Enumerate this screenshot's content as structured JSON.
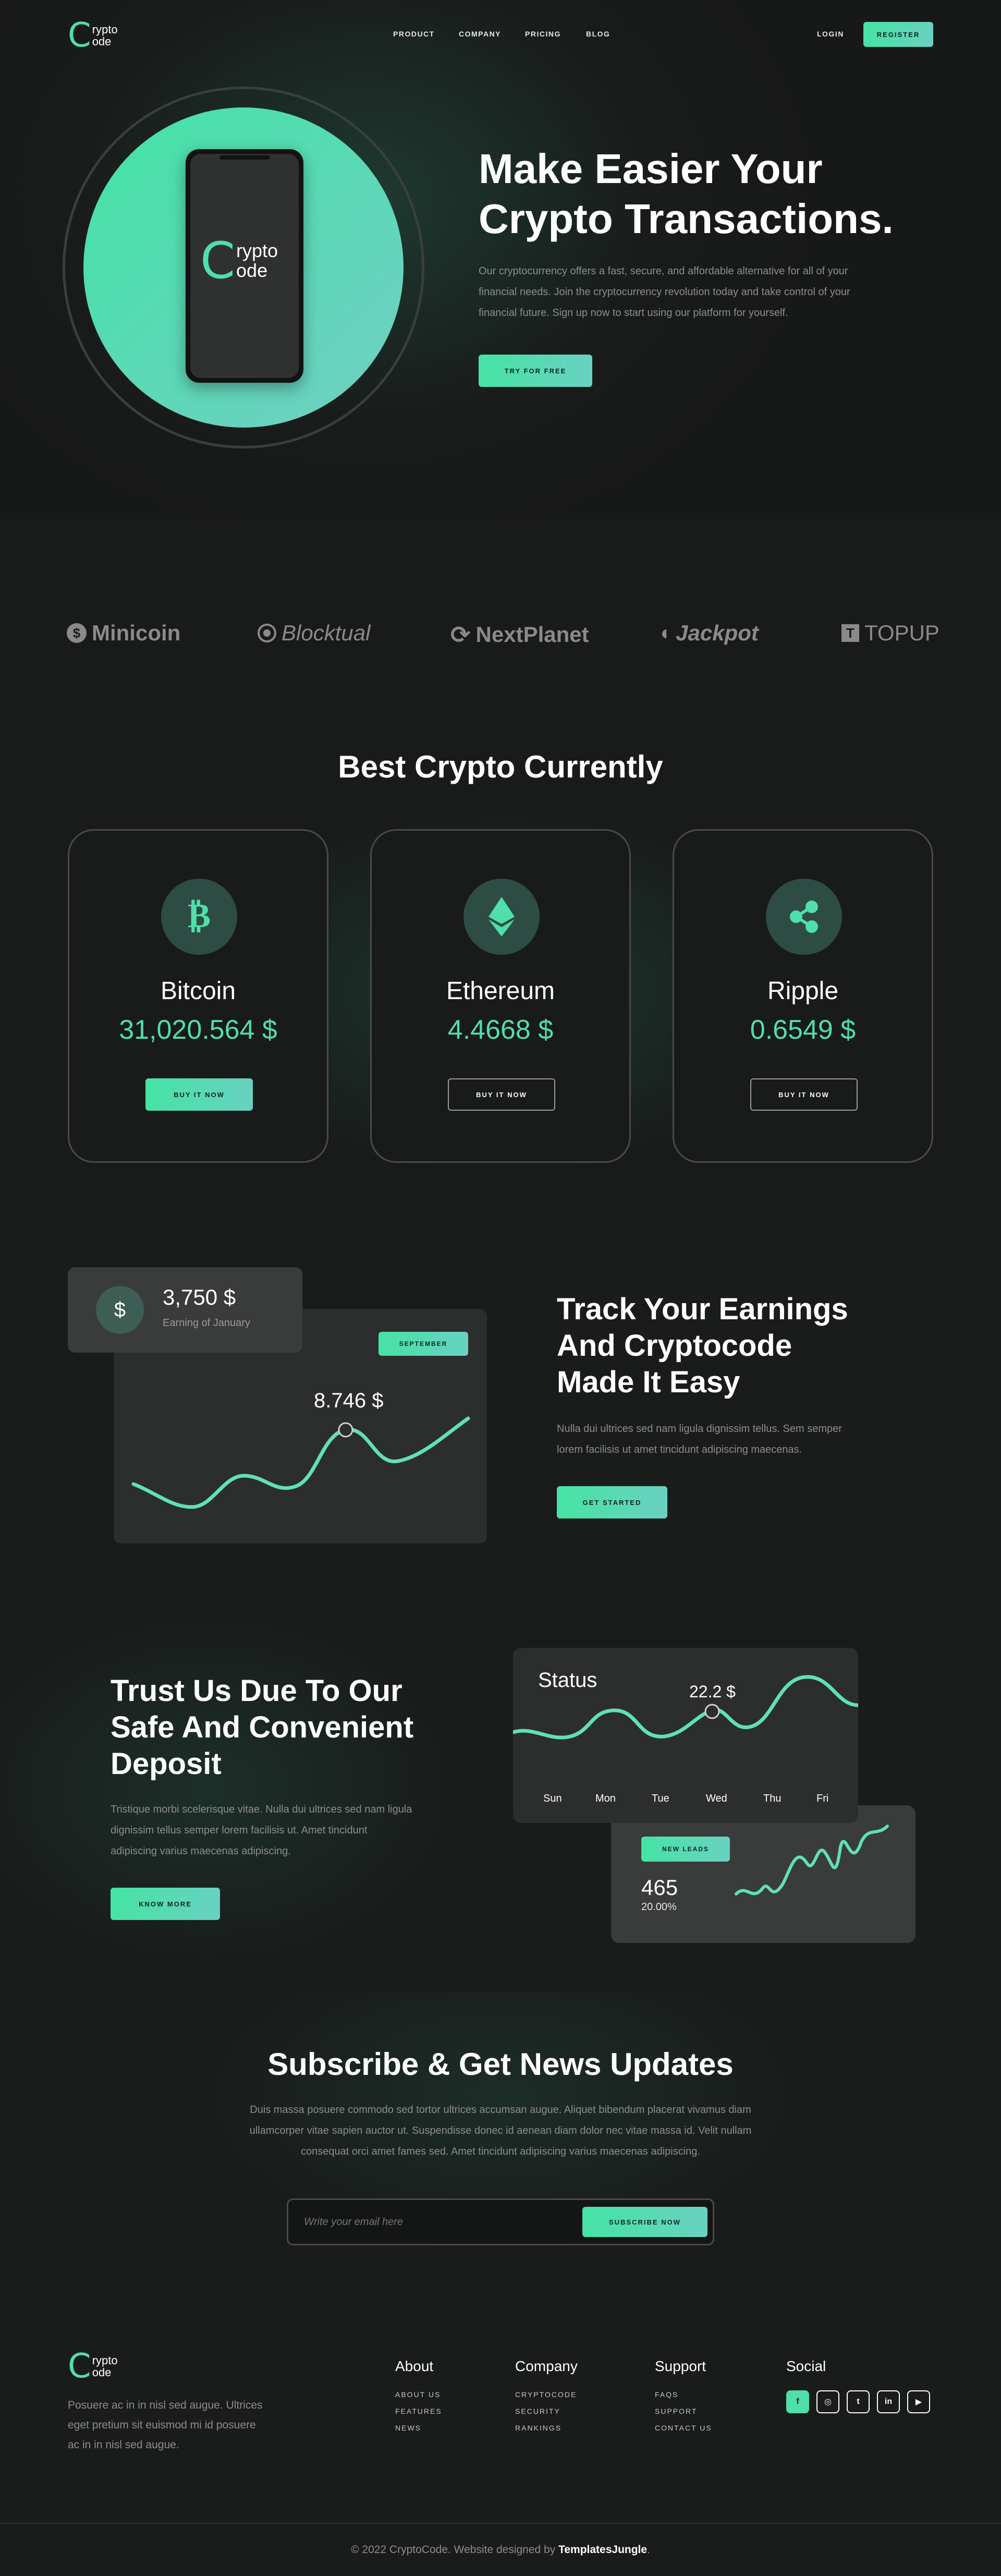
{
  "brand": {
    "logo_c": "C",
    "logo_top": "rypto",
    "logo_bottom": "ode"
  },
  "nav": {
    "links": [
      "PRODUCT",
      "COMPANY",
      "PRICING",
      "BLOG"
    ],
    "login": "LOGIN",
    "register": "REGISTER"
  },
  "hero": {
    "title_line1": "Make Easier Your",
    "title_line2": "Crypto Transactions.",
    "text_line1": "Our cryptocurrency offers a fast, secure, and affordable alternative for all of your",
    "text_line2": "financial needs. Join the cryptocurrency revolution today and take control of your",
    "text_line3": "financial future. Sign up now to start using our platform for yourself.",
    "cta": "TRY FOR FREE"
  },
  "partners": [
    "Minicoin",
    "Blocktual",
    "NextPlanet",
    "Jackpot",
    "TOPUP"
  ],
  "crypto": {
    "title": "Best Crypto Currently",
    "cards": [
      {
        "name": "Bitcoin",
        "price": "31,020.564 $",
        "button": "BUY IT NOW",
        "icon": "bitcoin-icon"
      },
      {
        "name": "Ethereum",
        "price": "4.4668 $",
        "button": "BUY IT NOW",
        "icon": "ethereum-icon"
      },
      {
        "name": "Ripple",
        "price": "0.6549 $",
        "button": "BUY IT NOW",
        "icon": "ripple-icon"
      }
    ]
  },
  "earnings": {
    "amount": "3,750 $",
    "amount_label": "Earning of January",
    "month_badge": "SEPTEMBER",
    "chart_value": "8.746 $",
    "title_line1": "Track Your Earnings",
    "title_line2": "And Cryptocode",
    "title_line3": "Made It Easy",
    "text_line1": "Nulla dui ultrices sed nam ligula dignissim tellus. Sem semper",
    "text_line2": "lorem facilisis ut amet tincidunt adipiscing maecenas.",
    "cta": "GET STARTED"
  },
  "trust": {
    "title_line1": "Trust Us Due To Our",
    "title_line2": "Safe And Convenient",
    "title_line3": "Deposit",
    "text_line1": "Tristique morbi scelerisque vitae. Nulla dui ultrices sed nam ligula",
    "text_line2": "dignissim tellus semper lorem facilisis ut. Amet tincidunt",
    "text_line3": "adipiscing varius maecenas adipiscing.",
    "cta": "KNOW MORE",
    "status_title": "Status",
    "status_value": "22.2 $",
    "days": [
      "Sun",
      "Mon",
      "Tue",
      "Wed",
      "Thu",
      "Fri"
    ],
    "leads_badge": "NEW LEADS",
    "leads_value": "465",
    "leads_percent": "20.00%"
  },
  "subscribe": {
    "title": "Subscribe & Get News Updates",
    "text_line1": "Duis massa posuere commodo sed tortor ultrices accumsan augue. Aliquet bibendum placerat vivamus diam",
    "text_line2": "ullamcorper vitae sapien auctor ut. Suspendisse donec id aenean diam dolor nec vitae massa id. Velit nullam",
    "text_line3": "consequat orci amet fames sed. Amet tincidunt adipiscing varius maecenas adipiscing.",
    "placeholder": "Write your email here",
    "button": "SUBSCRIBE NOW"
  },
  "footer": {
    "about_text_line1": "Posuere ac in in nisl sed augue. Ultrices",
    "about_text_line2": "eget pretium sit euismod mi id posuere",
    "about_text_line3": "ac in in nisl sed augue.",
    "columns": [
      {
        "title": "About",
        "links": [
          "ABOUT US",
          "FEATURES",
          "NEWS"
        ]
      },
      {
        "title": "Company",
        "links": [
          "CRYPTOCODE",
          "SECURITY",
          "RANKINGS"
        ]
      },
      {
        "title": "Support",
        "links": [
          "FAQS",
          "SUPPORT",
          "CONTACT US"
        ]
      }
    ],
    "social_title": "Social",
    "social": [
      {
        "label": "f",
        "icon": "facebook-icon"
      },
      {
        "label": "◎",
        "icon": "instagram-icon"
      },
      {
        "label": "t",
        "icon": "twitter-icon"
      },
      {
        "label": "in",
        "icon": "linkedin-icon"
      },
      {
        "label": "▶",
        "icon": "youtube-icon"
      }
    ],
    "copyright": "© 2022 CryptoCode. Website designed by",
    "designer": "TemplatesJungle",
    "period": "."
  }
}
